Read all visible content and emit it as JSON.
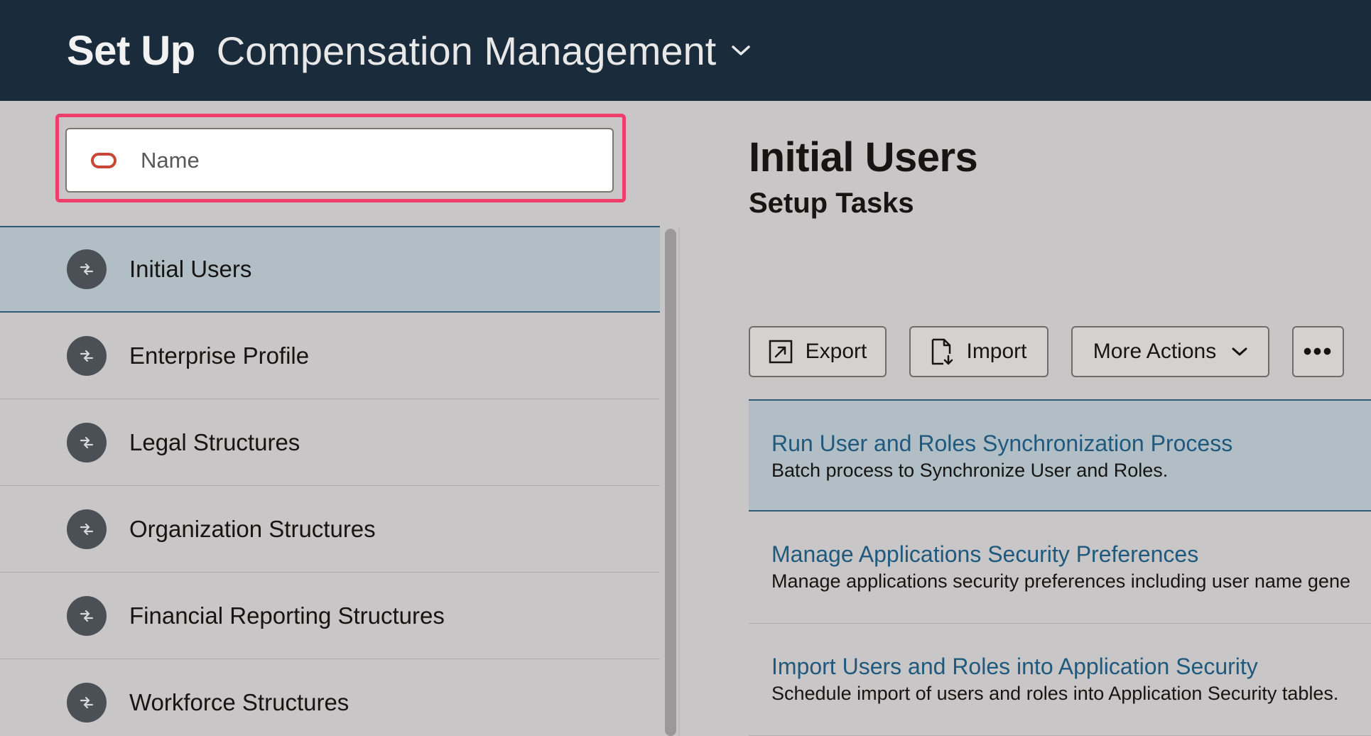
{
  "header": {
    "setup_label": "Set Up",
    "module_label": "Compensation Management",
    "module_chevron_icon": "chevron-down-icon",
    "background": "#1a2c3c"
  },
  "search": {
    "placeholder": "Name",
    "value": "",
    "icon": "oracle-pill-icon",
    "focus_color": "#ee3f6b"
  },
  "sidebar": {
    "items": [
      {
        "label": "Initial Users",
        "icon": "functional-area-icon",
        "selected": true
      },
      {
        "label": "Enterprise Profile",
        "icon": "functional-area-icon",
        "selected": false
      },
      {
        "label": "Legal Structures",
        "icon": "functional-area-icon",
        "selected": false
      },
      {
        "label": "Organization Structures",
        "icon": "functional-area-icon",
        "selected": false
      },
      {
        "label": "Financial Reporting Structures",
        "icon": "functional-area-icon",
        "selected": false
      },
      {
        "label": "Workforce Structures",
        "icon": "functional-area-icon",
        "selected": false
      }
    ]
  },
  "main": {
    "title": "Initial Users",
    "subtitle": "Setup Tasks",
    "toolbar": {
      "export_label": "Export",
      "import_label": "Import",
      "more_actions_label": "More Actions",
      "overflow_label": "•••"
    },
    "tasks": [
      {
        "title": "Run User and Roles Synchronization Process",
        "description": "Batch process to Synchronize User and Roles.",
        "selected": true
      },
      {
        "title": "Manage Applications Security Preferences",
        "description": "Manage applications security preferences including user name gene",
        "selected": false
      },
      {
        "title": "Import Users and Roles into Application Security",
        "description": "Schedule import of users and roles into Application Security tables.",
        "selected": false
      }
    ],
    "link_color": "#1f5a7e",
    "selected_bg": "#b1bec5"
  }
}
